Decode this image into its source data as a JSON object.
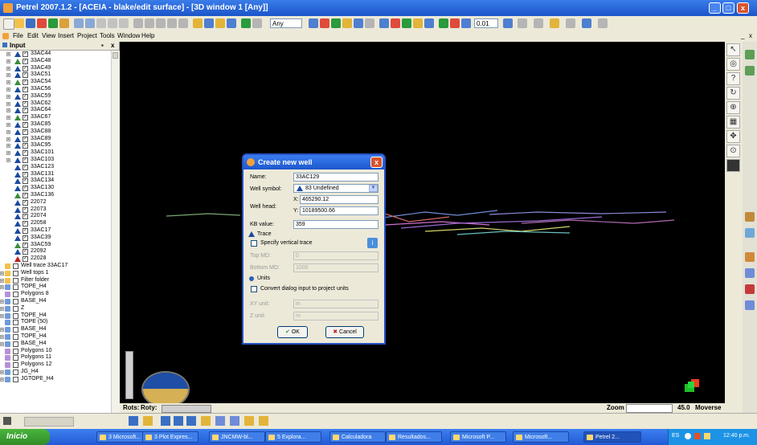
{
  "window": {
    "title": "Petrel 2007.1.2 - [ACEIA - blake/edit surface] - [3D window 1 [Any]]",
    "minimize": "_",
    "maximize": "□",
    "close": "x"
  },
  "toolbar": {
    "combo_any": "Any",
    "combo_value": "0.01"
  },
  "menubar": {
    "items": [
      "File",
      "Edit",
      "View",
      "Insert",
      "Project",
      "Tools",
      "Window",
      "Help"
    ]
  },
  "left_panel": {
    "tab": "Input",
    "tree": [
      {
        "label": "33AC44",
        "icon": "well-icon-blue",
        "indent": 1,
        "expander": "+"
      },
      {
        "label": "33AC48",
        "icon": "well-icon-green",
        "indent": 1,
        "expander": "+"
      },
      {
        "label": "33AC49",
        "icon": "well-icon-blue",
        "indent": 1,
        "expander": "+"
      },
      {
        "label": "33AC51",
        "icon": "well-icon-blue",
        "indent": 1,
        "expander": "+"
      },
      {
        "label": "33AC54",
        "icon": "well-icon-green",
        "indent": 1,
        "expander": "+"
      },
      {
        "label": "33AC56",
        "icon": "well-icon-blue",
        "indent": 1,
        "expander": "+"
      },
      {
        "label": "33AC59",
        "icon": "well-icon-blue",
        "indent": 1,
        "expander": "+"
      },
      {
        "label": "33AC62",
        "icon": "well-icon-blue",
        "indent": 1,
        "expander": "+"
      },
      {
        "label": "33AC64",
        "icon": "well-icon-blue",
        "indent": 1,
        "expander": "+"
      },
      {
        "label": "33AC67",
        "icon": "well-icon-green",
        "indent": 1,
        "expander": "+"
      },
      {
        "label": "33AC85",
        "icon": "well-icon-blue",
        "indent": 1,
        "expander": "+"
      },
      {
        "label": "33AC88",
        "icon": "well-icon-blue",
        "indent": 1,
        "expander": "+"
      },
      {
        "label": "33AC89",
        "icon": "well-icon-blue",
        "indent": 1,
        "expander": "+"
      },
      {
        "label": "33AC95",
        "icon": "well-icon-blue",
        "indent": 1,
        "expander": "+"
      },
      {
        "label": "33AC101",
        "icon": "well-icon-blue",
        "indent": 1,
        "expander": "+"
      },
      {
        "label": "33AC103",
        "icon": "well-icon-blue",
        "indent": 1,
        "expander": "+"
      },
      {
        "label": "33AC123",
        "icon": "well-icon-blue",
        "indent": 1,
        "expander": ""
      },
      {
        "label": "33AC131",
        "icon": "well-icon-blue",
        "indent": 1,
        "expander": ""
      },
      {
        "label": "33AC134",
        "icon": "well-icon-blue",
        "indent": 1,
        "expander": ""
      },
      {
        "label": "33AC130",
        "icon": "well-icon-blue",
        "indent": 1,
        "expander": ""
      },
      {
        "label": "33AC136",
        "icon": "well-icon-green",
        "indent": 1,
        "expander": ""
      },
      {
        "label": "22072",
        "icon": "well-icon-blue",
        "indent": 1,
        "expander": ""
      },
      {
        "label": "22073",
        "icon": "well-icon-blue",
        "indent": 1,
        "expander": ""
      },
      {
        "label": "22074",
        "icon": "well-icon-blue",
        "indent": 1,
        "expander": ""
      },
      {
        "label": "22058",
        "icon": "well-icon-blue",
        "indent": 1,
        "expander": ""
      },
      {
        "label": "33AC17",
        "icon": "well-icon-blue",
        "indent": 1,
        "expander": ""
      },
      {
        "label": "33AC39",
        "icon": "well-icon-blue",
        "indent": 1,
        "expander": ""
      },
      {
        "label": "33AC59",
        "icon": "well-icon-green",
        "indent": 1,
        "expander": ""
      },
      {
        "label": "22092",
        "icon": "well-icon-blue",
        "indent": 1,
        "expander": ""
      },
      {
        "label": "22028",
        "icon": "well-icon-red",
        "indent": 1,
        "expander": ""
      },
      {
        "label": "Well trace 33AC17",
        "icon": "folder-icon",
        "indent": 0,
        "expander": ""
      },
      {
        "label": "Well tops 1",
        "icon": "folder-icon",
        "indent": 0,
        "expander": "+"
      },
      {
        "label": "Filter folder",
        "icon": "folder-icon",
        "indent": 0,
        "expander": "+"
      },
      {
        "label": "TOPE_H4",
        "icon": "surface-icon",
        "indent": 0,
        "expander": "+"
      },
      {
        "label": "Polygons 8",
        "icon": "polygon-icon",
        "indent": 0,
        "expander": ""
      },
      {
        "label": "BASE_H4",
        "icon": "surface-icon",
        "indent": 0,
        "expander": "+"
      },
      {
        "label": "Z",
        "icon": "surface-icon",
        "indent": 0,
        "expander": "+"
      },
      {
        "label": "TOPE_H4",
        "icon": "surface-icon",
        "indent": 0,
        "expander": "+"
      },
      {
        "label": "TOPE (50)",
        "icon": "surface-icon",
        "indent": 0,
        "expander": ""
      },
      {
        "label": "BASE_H4",
        "icon": "surface-icon",
        "indent": 0,
        "expander": "+"
      },
      {
        "label": "TOPE_H4",
        "icon": "surface-icon",
        "indent": 0,
        "expander": "+"
      },
      {
        "label": "BASE_H4",
        "icon": "surface-icon",
        "indent": 0,
        "expander": "+"
      },
      {
        "label": "Polygons 10",
        "icon": "polygon-icon",
        "indent": 0,
        "expander": ""
      },
      {
        "label": "Polygons 11",
        "icon": "polygon-icon",
        "indent": 0,
        "expander": ""
      },
      {
        "label": "Polygons 12",
        "icon": "polygon-icon",
        "indent": 0,
        "expander": ""
      },
      {
        "label": "JG_H4",
        "icon": "surface-icon",
        "indent": 0,
        "expander": "+"
      },
      {
        "label": "JGTOPE_H4",
        "icon": "surface-icon",
        "indent": 0,
        "expander": "+"
      }
    ]
  },
  "dialog": {
    "title": "Create new well",
    "close": "x",
    "name_label": "Name:",
    "name_value": "33AC129",
    "symbol_label": "Well symbol:",
    "symbol_value": "83 Undefined",
    "head_label": "Well head:",
    "x_label": "X:",
    "x_value": "465290.12",
    "y_label": "Y:",
    "y_value": "10189500.66",
    "kb_label": "KB value:",
    "kb_value": "359",
    "trace_label": "Trace",
    "specify_trace_label": "Specify vertical trace",
    "topmd_label": "Top MD:",
    "topmd_value": "0",
    "bottommd_label": "Bottom MD:",
    "bottommd_value": "1000",
    "units_label": "Units",
    "convert_label": "Convert dialog input to project units",
    "xyunit_label": "XY unit:",
    "xyunit_value": "m",
    "zunit_label": "Z unit:",
    "zunit_value": "m",
    "ok_label": "OK",
    "cancel_label": "Cancel"
  },
  "viewport_footer": {
    "rots": "Rots:",
    "rots2": "Roty:",
    "zoom_label": "Zoom",
    "zoom_value": "45.0",
    "mode": "Moverse"
  },
  "taskbar": {
    "start": "Inicio",
    "tasks": [
      "3 Microsoft...",
      "3 Plot Expres...",
      "JNCMW-bl...",
      "5 Explora...",
      "Calculadora",
      "Resultados...",
      "Microsoft P...",
      "Microsoft...",
      "Petrel 2..."
    ],
    "tray_lang": "ES",
    "clock": "12:40 p.m."
  },
  "colors": {
    "titlebar": "#1b55c9",
    "viewport_bg": "#000000",
    "panel_bg": "#ece9d8"
  }
}
